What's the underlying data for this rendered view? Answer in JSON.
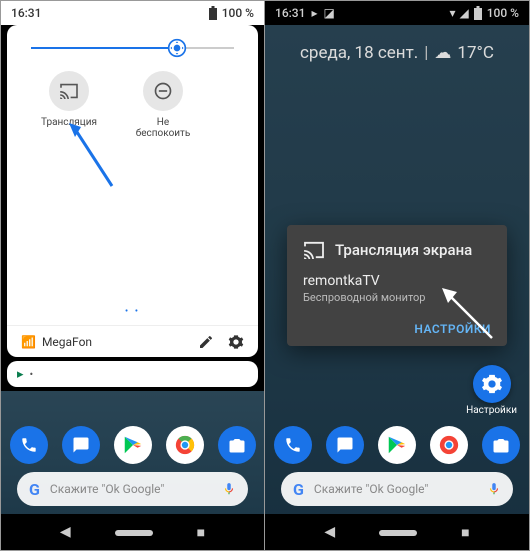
{
  "left": {
    "status": {
      "time": "16:31",
      "battery_text": "100 %"
    },
    "tiles": [
      {
        "label": "Трансляция"
      },
      {
        "label": "Не беспокоить"
      }
    ],
    "footer": {
      "signal_icon": "📶",
      "carrier": "MegaFon"
    },
    "notif": {
      "app_icon": "▸",
      "dot": "•"
    }
  },
  "right": {
    "status": {
      "time": "16:31",
      "battery_text": "100 %"
    },
    "date": "среда, 18 сент.",
    "weather": {
      "icon": "☁",
      "temp": "17°C"
    },
    "cast": {
      "title": "Трансляция экрана",
      "device": "remontkaTV",
      "subtitle": "Беспроводной монитор",
      "action": "НАСТРОЙКИ"
    },
    "settings_widget": {
      "label": "Настройки"
    },
    "search": {
      "placeholder": "Скажите \"Ok Google\""
    }
  }
}
